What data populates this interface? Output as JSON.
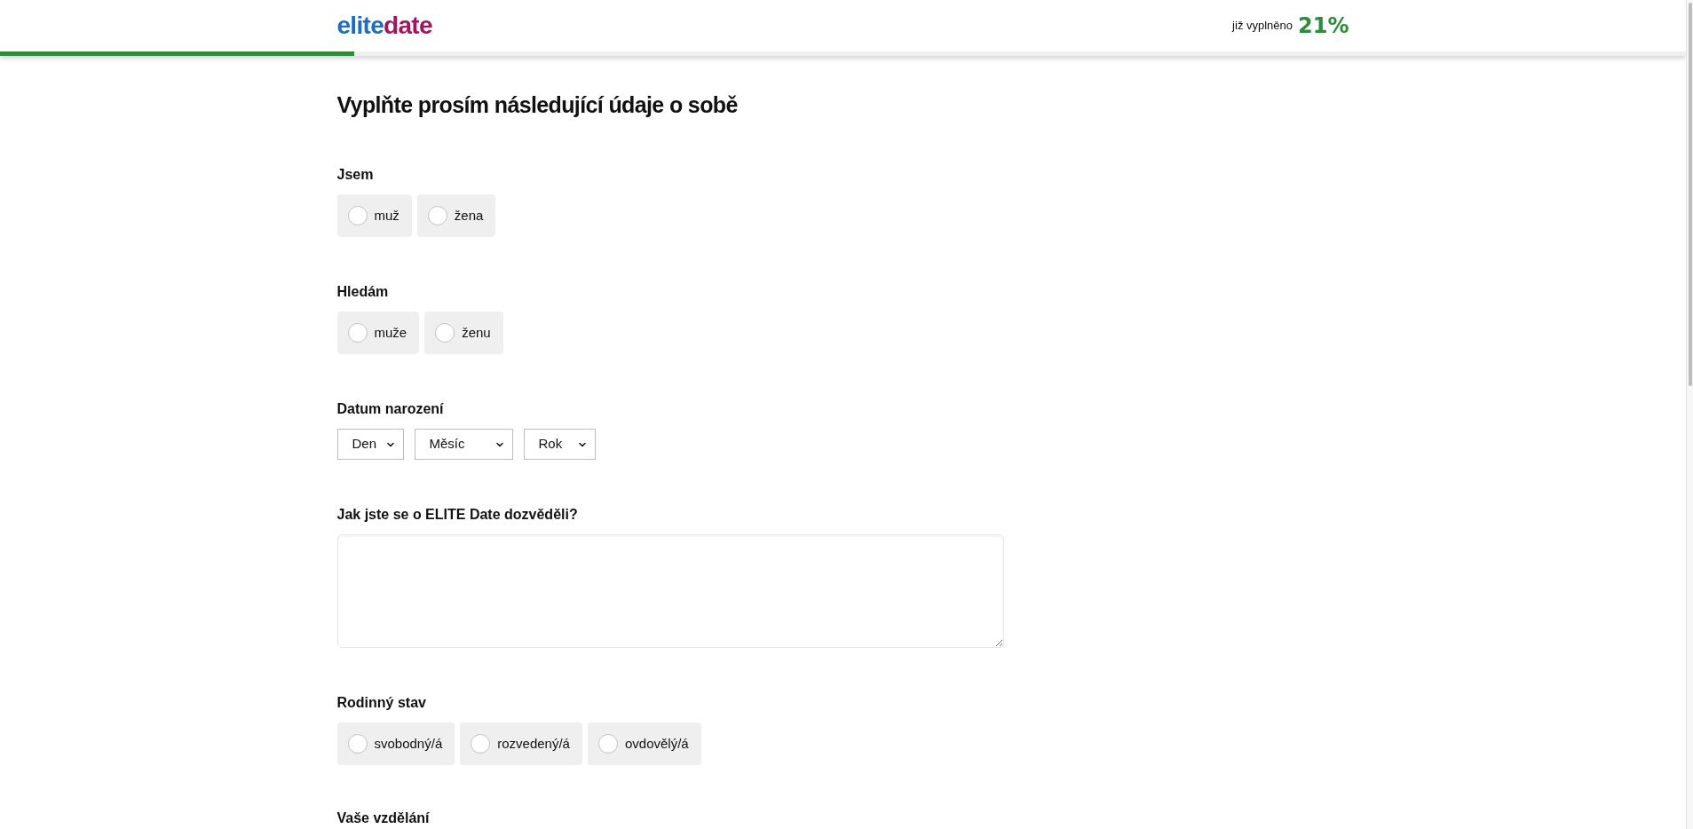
{
  "header": {
    "logo": {
      "part_1": "elite",
      "part_2": "date"
    },
    "progress": {
      "label": "již vyplněno",
      "value": "21%",
      "level": 0.21
    }
  },
  "title": "Vyplňte prosím následující údaje o sobě",
  "fields": [
    {
      "kind": "radio",
      "label": "Jsem",
      "options": [
        {
          "label": "muž",
          "selected": false
        },
        {
          "label": "žena",
          "selected": false
        }
      ]
    },
    {
      "kind": "radio",
      "label": "Hledám",
      "options": [
        {
          "label": "muže",
          "selected": false
        },
        {
          "label": "ženu",
          "selected": false
        }
      ]
    },
    {
      "kind": "date",
      "label": "Datum narození",
      "selects": [
        {
          "value": "Den"
        },
        {
          "value": "Měsíc"
        },
        {
          "value": "Rok"
        }
      ]
    },
    {
      "kind": "textarea",
      "label": "Jak jste se o ELITE Date dozvěděli?"
    },
    {
      "kind": "radio",
      "label": "Rodinný stav",
      "options": [
        {
          "label": "svobodný/á",
          "selected": false
        },
        {
          "label": "rozvedený/á",
          "selected": false
        },
        {
          "label": "ovdovělý/á",
          "selected": false
        }
      ]
    },
    {
      "kind": "heading",
      "label": "Vaše vzdělání"
    }
  ]
}
